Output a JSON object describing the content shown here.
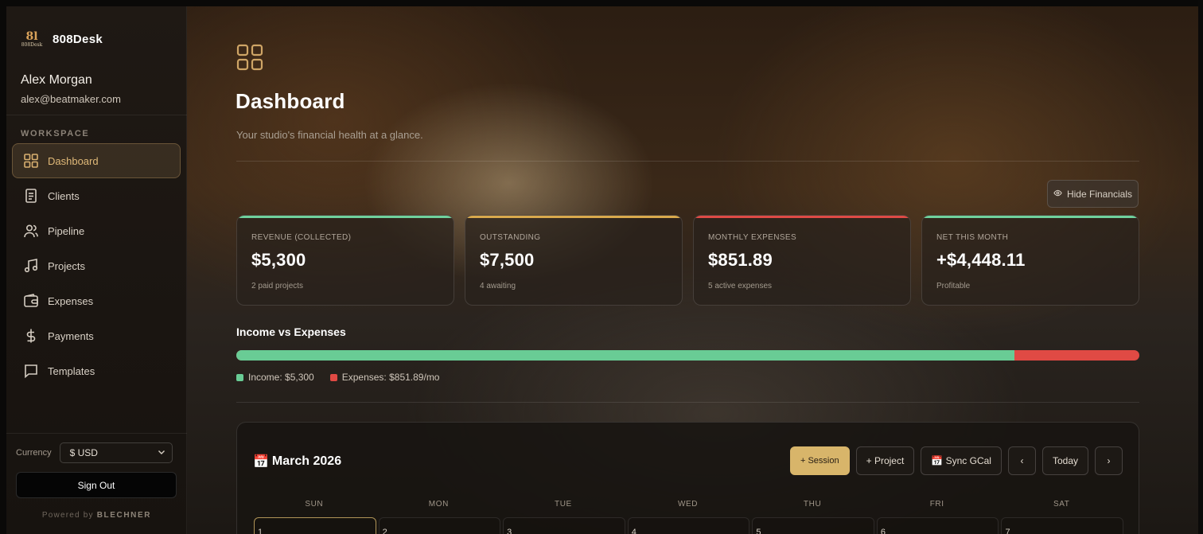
{
  "app": {
    "name": "808Desk",
    "logo_text": "808Desk"
  },
  "user": {
    "name": "Alex Morgan",
    "email": "alex@beatmaker.com"
  },
  "sidebar": {
    "section_label": "WORKSPACE",
    "items": [
      {
        "label": "Dashboard",
        "icon": "grid-icon",
        "active": true
      },
      {
        "label": "Clients",
        "icon": "document-icon"
      },
      {
        "label": "Pipeline",
        "icon": "users-icon"
      },
      {
        "label": "Projects",
        "icon": "music-note-icon"
      },
      {
        "label": "Expenses",
        "icon": "wallet-icon"
      },
      {
        "label": "Payments",
        "icon": "dollar-icon"
      },
      {
        "label": "Templates",
        "icon": "message-icon"
      }
    ],
    "currency_label": "Currency",
    "currency_value": "$ USD",
    "signout_label": "Sign Out",
    "powered_prefix": "Powered by",
    "powered_brand": "BLECHNER"
  },
  "page": {
    "title": "Dashboard",
    "subtitle": "Your studio's financial health at a glance.",
    "hide_financials_label": "Hide Financials"
  },
  "cards": [
    {
      "label": "REVENUE (COLLECTED)",
      "value": "$5,300",
      "note": "2 paid projects",
      "accent": "#6fd19c"
    },
    {
      "label": "OUTSTANDING",
      "value": "$7,500",
      "note": "4 awaiting",
      "accent": "#d9a94c"
    },
    {
      "label": "MONTHLY EXPENSES",
      "value": "$851.89",
      "note": "5 active expenses",
      "accent": "#de4a45"
    },
    {
      "label": "NET THIS MONTH",
      "value": "+$4,448.11",
      "note": "Profitable",
      "accent": "#6fd19c"
    }
  ],
  "income_vs_expenses": {
    "title": "Income vs Expenses",
    "income_value": 5300,
    "expenses_value": 851.89,
    "income_label": "Income: $5,300",
    "expenses_label": "Expenses: $851.89/mo",
    "income_color": "#69cc95",
    "expenses_color": "#e04a44"
  },
  "calendar": {
    "title": "March 2026",
    "buttons": {
      "session": "+ Session",
      "project": "+ Project",
      "sync": "Sync GCal",
      "prev": "‹",
      "today": "Today",
      "next": "›"
    },
    "weekdays": [
      "SUN",
      "MON",
      "TUE",
      "WED",
      "THU",
      "FRI",
      "SAT"
    ],
    "days": [
      "1",
      "2",
      "3",
      "4",
      "5",
      "6",
      "7"
    ]
  }
}
